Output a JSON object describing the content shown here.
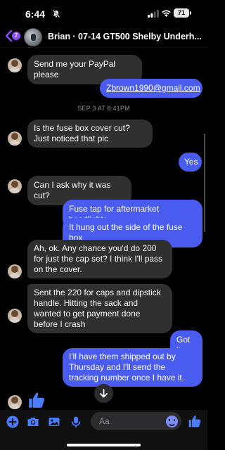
{
  "status_bar": {
    "time": "6:44",
    "battery": "71"
  },
  "header": {
    "back_badge": "7",
    "title": "Brian · 07-14 GT500 Shelby Underh..."
  },
  "timestamp": "SEP 3 AT 8:41PM",
  "messages": [
    {
      "text": "Send me your PayPal please"
    },
    {
      "text": "Zbrown1990@gmail.com"
    },
    {
      "text": "Is the fuse box cover cut? Just noticed that pic"
    },
    {
      "text": "Yes"
    },
    {
      "text": "Can I ask why it was cut?"
    },
    {
      "text": "Fuse tap for aftermarket headlights"
    },
    {
      "text": "It hung out the side of the fuse box."
    },
    {
      "text": "Ah, ok. Any chance you'd do 200 for just the cap set? I think I'll pass on the cover."
    },
    {
      "text": "Sent the 220 for caps and dipstick handle. Hitting the sack and wanted to get payment done before I crash"
    },
    {
      "text": "Got it."
    },
    {
      "text": "I'll have them shipped out by Thursday and I'll send the tracking number once I have it."
    }
  ],
  "composer": {
    "placeholder": "Aa"
  },
  "colors": {
    "accent": "#4a5cf0",
    "incoming": "#303030",
    "badge": "#8e4bff"
  },
  "icons": [
    "back-chevron-icon",
    "plus-icon",
    "camera-icon",
    "image-icon",
    "microphone-icon",
    "emoji-icon",
    "thumbs-up-icon",
    "chevron-down-icon"
  ]
}
